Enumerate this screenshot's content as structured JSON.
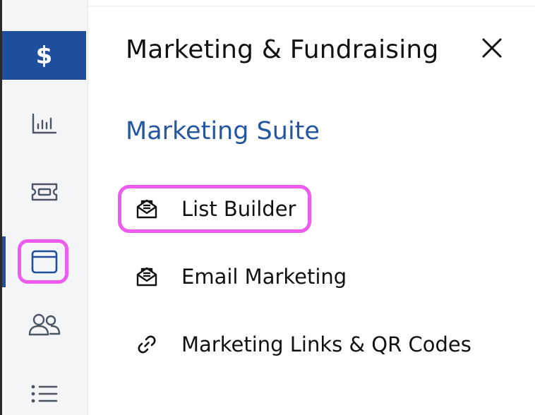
{
  "sidebar": {
    "items": [
      {
        "name": "fundraising",
        "glyph": "$",
        "active": true
      },
      {
        "name": "reports",
        "icon": "bar-chart-icon"
      },
      {
        "name": "tickets",
        "icon": "ticket-icon"
      },
      {
        "name": "marketing",
        "icon": "browser-window-icon",
        "highlighted": true
      },
      {
        "name": "people",
        "icon": "users-icon"
      },
      {
        "name": "lists",
        "icon": "list-icon"
      }
    ]
  },
  "panel": {
    "title": "Marketing & Fundraising",
    "close_icon": "close-icon",
    "section": {
      "heading": "Marketing Suite",
      "items": [
        {
          "label": "List Builder",
          "icon": "envelope-open-icon",
          "highlighted": true
        },
        {
          "label": "Email Marketing",
          "icon": "envelope-open-icon"
        },
        {
          "label": "Marketing Links & QR Codes",
          "icon": "link-icon"
        }
      ]
    }
  },
  "colors": {
    "brand_blue": "#1e4e9c",
    "heading_blue": "#2457a0",
    "highlight": "#ee5bef",
    "sidebar_bg": "#f4f5f7",
    "icon_gray": "#4a5563"
  }
}
